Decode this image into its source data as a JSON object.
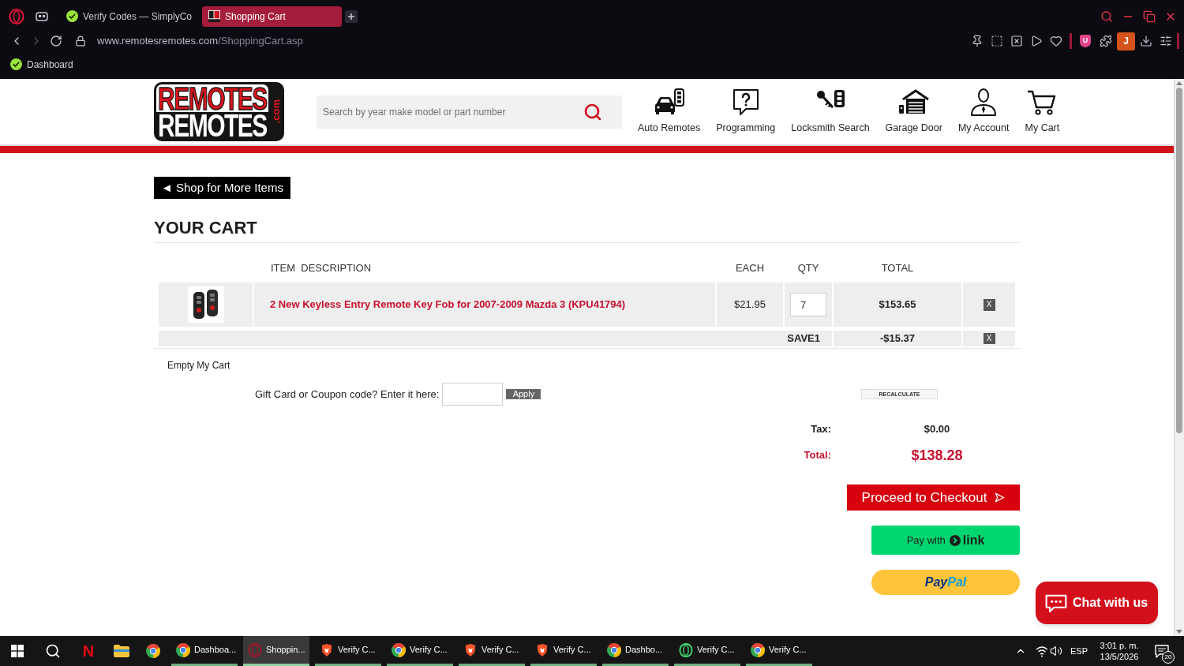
{
  "browser": {
    "tabs": [
      {
        "title": "Verify Codes — SimplyCo",
        "kind": "check",
        "selected": false
      },
      {
        "title": "Shopping Cart",
        "kind": "favicon",
        "selected": true
      }
    ],
    "nav_buttons": [
      {
        "kind": "back",
        "disabled": false
      },
      {
        "kind": "forward",
        "disabled": true
      },
      {
        "kind": "reload",
        "disabled": false
      }
    ],
    "url": {
      "host": "www.remotesremotes.com",
      "path": "/ShoppingCart.asp"
    },
    "extension_badge": "U",
    "profile_initial": "J",
    "bookmarks": [
      {
        "label": "Dashboard",
        "kind": "check"
      }
    ]
  },
  "header": {
    "logo": {
      "top": "REMOTES",
      "bottom": "REMOTES",
      "suffix": ".com"
    },
    "search": {
      "placeholder": "Search by year make model or part number"
    },
    "nav": [
      {
        "label": "Auto Remotes",
        "kind": "car-remote"
      },
      {
        "label": "Programming",
        "kind": "question"
      },
      {
        "label": "Locksmith Search",
        "kind": "key"
      },
      {
        "label": "Garage Door",
        "kind": "garage"
      },
      {
        "label": "My Account",
        "kind": "user"
      },
      {
        "label": "My Cart",
        "kind": "cart"
      }
    ]
  },
  "cart": {
    "back_button": "◄ Shop for More Items",
    "title": "YOUR CART",
    "columns": [
      "ITEM  DESCRIPTION",
      "EACH",
      "QTY",
      "TOTAL"
    ],
    "items": [
      {
        "description": "2 New Keyless Entry Remote Key Fob for 2007-2009 Mazda 3 (KPU41794)",
        "each": "$21.95",
        "qty": "7",
        "total": "$153.65",
        "remove": "X"
      }
    ],
    "discount": {
      "code": "SAVE1",
      "amount": "-$15.37",
      "remove": "X"
    },
    "empty_cart": "Empty My Cart",
    "coupon": {
      "label": "Gift Card or Coupon code? Enter it here:",
      "button": "Apply"
    },
    "recalculate": "RECALCULATE",
    "summary": [
      {
        "kind": "tax",
        "label": "Tax:",
        "value": "$0.00"
      },
      {
        "kind": "total",
        "label": "Total:",
        "value": "$138.28"
      }
    ],
    "checkout": "Proceed to Checkout",
    "link_pay": {
      "prefix": "Pay with",
      "brand": "link"
    },
    "paypal": {
      "parts": [
        "Pay",
        "Pal"
      ]
    }
  },
  "chat": {
    "label": "Chat with us"
  },
  "taskbar": {
    "pinned": [
      {
        "kind": "start"
      },
      {
        "kind": "search"
      },
      {
        "kind": "letter",
        "label": "N"
      },
      {
        "kind": "folder"
      },
      {
        "kind": "round"
      }
    ],
    "windows": [
      {
        "label": "Dashboa...",
        "kind": "round",
        "selected": false
      },
      {
        "label": "Shoppin...",
        "kind": "ring",
        "color": "#9c1c2c",
        "selected": true
      },
      {
        "label": "Verify C...",
        "kind": "shield",
        "selected": false
      },
      {
        "label": "Verify C...",
        "kind": "round",
        "selected": false
      },
      {
        "label": "Verify C...",
        "kind": "shield",
        "selected": false
      },
      {
        "label": "Verify C...",
        "kind": "shield",
        "selected": false
      },
      {
        "label": "Dashbo...",
        "kind": "round",
        "selected": false
      },
      {
        "label": "Verify C...",
        "kind": "ring",
        "color": "#3fd16a",
        "selected": false
      },
      {
        "label": "Verify C...",
        "kind": "round",
        "selected": false
      }
    ],
    "tray": {
      "language": "ESP",
      "time": "3:01 p. m.",
      "date": "13/5/2026",
      "notifications": "20"
    }
  }
}
